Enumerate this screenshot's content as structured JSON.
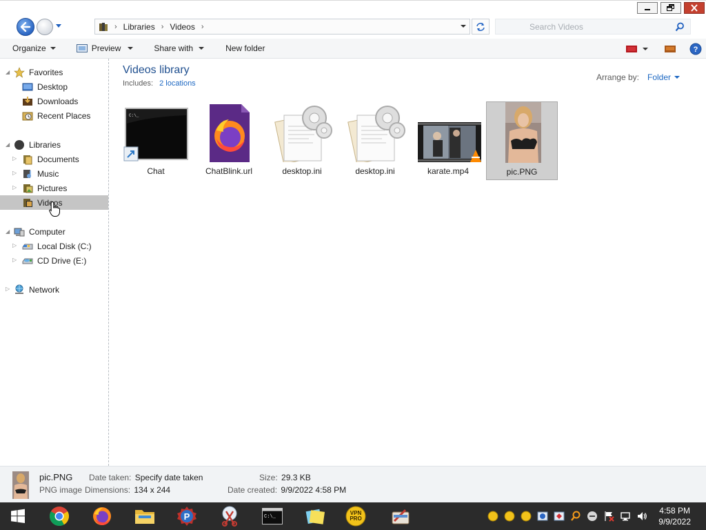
{
  "window": {
    "controls": [
      "minimize",
      "restore",
      "close"
    ]
  },
  "address": {
    "crumbs": [
      "Libraries",
      "Videos"
    ],
    "search_placeholder": "Search Videos"
  },
  "toolbar": {
    "organize": "Organize",
    "preview": "Preview",
    "share_with": "Share with",
    "new_folder": "New folder"
  },
  "nav": {
    "favorites": "Favorites",
    "desktop": "Desktop",
    "downloads": "Downloads",
    "recent_places": "Recent Places",
    "libraries": "Libraries",
    "documents": "Documents",
    "music": "Music",
    "pictures": "Pictures",
    "videos": "Videos",
    "computer": "Computer",
    "local_disk": "Local Disk (C:)",
    "cd_drive": "CD Drive (E:)",
    "network": "Network"
  },
  "library": {
    "title": "Videos library",
    "includes_label": "Includes:",
    "includes_link": "2 locations",
    "arrange_label": "Arrange by:",
    "arrange_value": "Folder"
  },
  "files": [
    {
      "name": "Chat",
      "kind": "cmd-shortcut"
    },
    {
      "name": "ChatBlink.url",
      "kind": "firefox"
    },
    {
      "name": "desktop.ini",
      "kind": "settings"
    },
    {
      "name": "desktop.ini",
      "kind": "settings"
    },
    {
      "name": "karate.mp4",
      "kind": "video"
    },
    {
      "name": "pic.PNG",
      "kind": "image",
      "selected": true
    }
  ],
  "details": {
    "name": "pic.PNG",
    "type": "PNG image",
    "date_taken_label": "Date taken:",
    "date_taken_value": "Specify date taken",
    "dimensions_label": "Dimensions:",
    "dimensions_value": "134 x 244",
    "size_label": "Size:",
    "size_value": "29.3 KB",
    "date_created_label": "Date created:",
    "date_created_value": "9/9/2022 4:58 PM"
  },
  "taskbar": {
    "time": "4:58 PM",
    "date": "9/9/2022",
    "vpn_label_1": "VPN",
    "vpn_label_2": "PRO"
  },
  "colors": {
    "accent_link": "#1c67c2",
    "title_blue": "#1f4f8f",
    "selection": "#c5c5c5",
    "taskbar": "#2b2b2b"
  }
}
